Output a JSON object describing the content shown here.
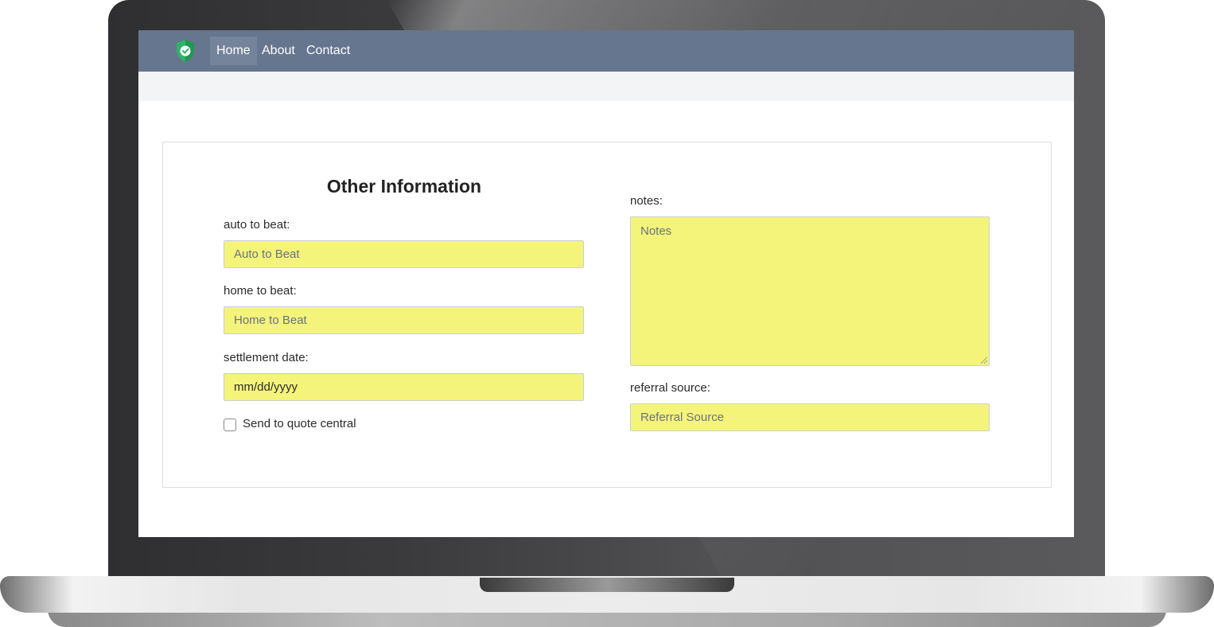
{
  "navbar": {
    "logo_icon": "shield-check-icon",
    "items": [
      {
        "label": "Home",
        "active": true
      },
      {
        "label": "About",
        "active": false
      },
      {
        "label": "Contact",
        "active": false
      }
    ],
    "background": "#66768f"
  },
  "form": {
    "title": "Other Information",
    "auto_to_beat": {
      "label": "auto to beat:",
      "placeholder": "Auto to Beat"
    },
    "home_to_beat": {
      "label": "home to beat:",
      "placeholder": "Home to Beat"
    },
    "settlement_date": {
      "label": "settlement date:",
      "value": "mm/dd/yyyy"
    },
    "send_to_quote_central": {
      "label": "Send to quote central",
      "checked": false
    },
    "notes": {
      "label": "notes:",
      "placeholder": "Notes"
    },
    "referral_source": {
      "label": "referral source:",
      "placeholder": "Referral Source"
    },
    "field_color": "#f4f47a"
  }
}
